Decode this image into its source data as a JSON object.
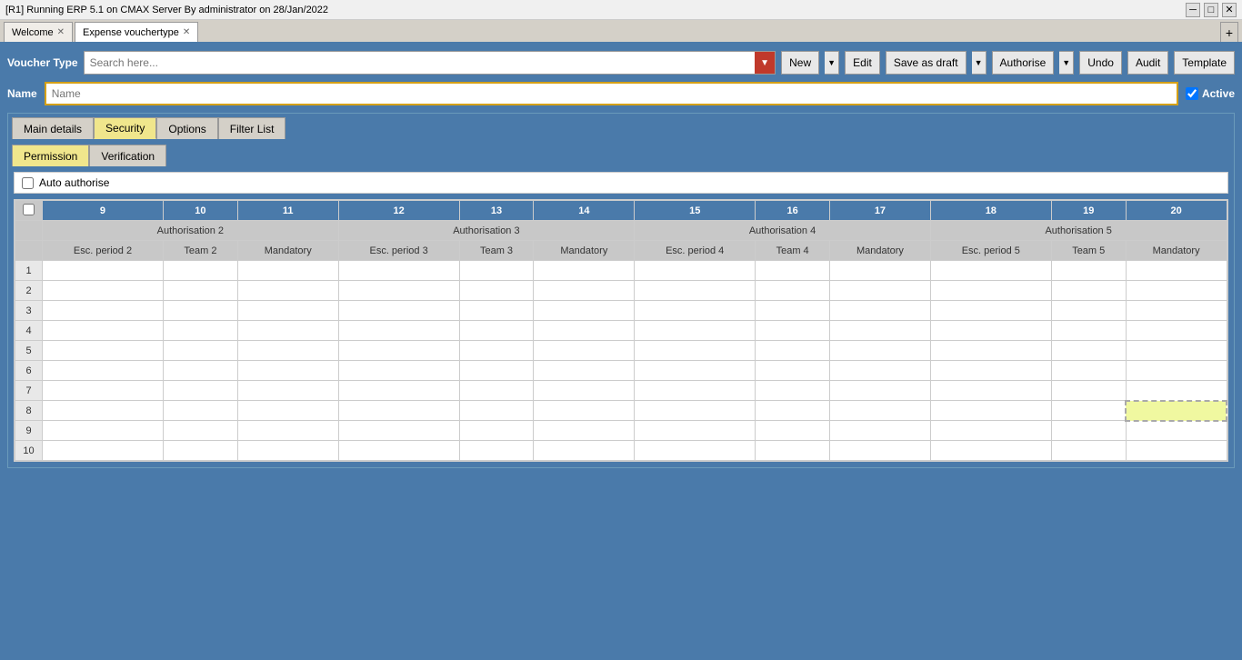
{
  "titlebar": {
    "title": "[R1] Running ERP 5.1 on CMAX Server By administrator on 28/Jan/2022",
    "minimize": "─",
    "restore": "□",
    "close": "✕"
  },
  "tabs": [
    {
      "label": "Welcome",
      "active": false,
      "closable": true
    },
    {
      "label": "Expense vouchertype",
      "active": true,
      "closable": true
    }
  ],
  "tab_add": "+",
  "toolbar": {
    "voucher_type_label": "Voucher Type",
    "search_placeholder": "Search here...",
    "new_btn": "New",
    "edit_btn": "Edit",
    "save_draft_btn": "Save as draft",
    "authorise_btn": "Authorise",
    "undo_btn": "Undo",
    "audit_btn": "Audit",
    "template_btn": "Template"
  },
  "name_row": {
    "label": "Name",
    "placeholder": "Name",
    "active_label": "Active",
    "active_checked": true
  },
  "content_tabs": [
    {
      "label": "Main details",
      "active": false
    },
    {
      "label": "Security",
      "active": true
    },
    {
      "label": "Options",
      "active": false
    },
    {
      "label": "Filter List",
      "active": false
    }
  ],
  "subtabs": [
    {
      "label": "Permission",
      "active": true
    },
    {
      "label": "Verification",
      "active": false
    }
  ],
  "auto_authorise": {
    "label": "Auto authorise",
    "checked": false
  },
  "grid": {
    "col_numbers": [
      "",
      "9",
      "10",
      "11",
      "12",
      "13",
      "14",
      "15",
      "16",
      "17",
      "18",
      "19",
      "20"
    ],
    "auth_groups": [
      {
        "label": "Authorisation 2",
        "colspan": 3
      },
      {
        "label": "Authorisation 3",
        "colspan": 3
      },
      {
        "label": "Authorisation 4",
        "colspan": 3
      },
      {
        "label": "Authorisation 5",
        "colspan": 3
      }
    ],
    "sub_headers": [
      "",
      "Esc. period 2",
      "Team 2",
      "Mandatory",
      "Esc. period 3",
      "Team 3",
      "Mandatory",
      "Esc. period 4",
      "Team 4",
      "Mandatory",
      "Esc. period 5",
      "Team 5",
      "Mandatory"
    ],
    "rows": [
      1,
      2,
      3,
      4,
      5,
      6,
      7,
      8,
      9,
      10
    ]
  }
}
